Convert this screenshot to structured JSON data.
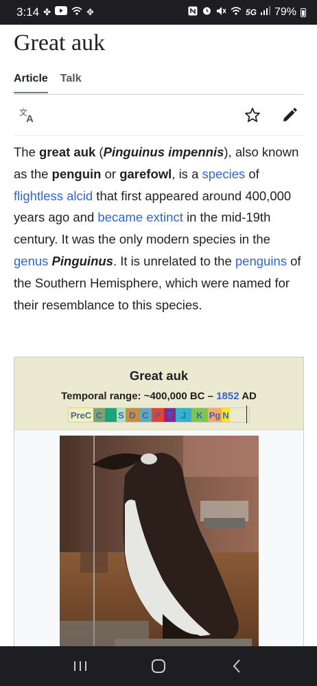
{
  "status_bar": {
    "time": "3:14",
    "left_icons": [
      "fan-icon",
      "youtube-icon",
      "wifi-calling-icon",
      "pinwheel-icon"
    ],
    "right_icons": [
      "nfc-icon",
      "alarm-icon",
      "mute-icon",
      "wifi-icon",
      "signal-icon"
    ],
    "network": "5G",
    "battery": "79%"
  },
  "page": {
    "title": "Great auk",
    "tabs": [
      {
        "label": "Article",
        "active": true
      },
      {
        "label": "Talk",
        "active": false
      }
    ]
  },
  "toolbar": {
    "icons": [
      "language-icon",
      "star-icon",
      "edit-pencil-icon"
    ]
  },
  "article": {
    "parts": {
      "p1": "The ",
      "b1": "great auk",
      "p2": " (",
      "bi1": "Pinguinus impennis",
      "p3": "), also known as the ",
      "b2": "penguin",
      "p4": " or ",
      "b3": "garefowl",
      "p5": ", is a ",
      "l1": "species",
      "p6": " of ",
      "l2": "flightless alcid",
      "p7": " that first appeared around 400,000 years ago and ",
      "l3": "became extinct",
      "p8": " in the mid-19th century. It was the only modern species in the ",
      "l4": "genus",
      "p9": " ",
      "bi2": "Pinguinus",
      "p10": ". It is unrelated to the ",
      "l5": "penguins",
      "p11": " of the Southern Hemisphere, which were named for their resemblance to this species."
    }
  },
  "infobox": {
    "title": "Great auk",
    "range_prefix": "Temporal range: ~400,000 BC – ",
    "range_link": "1852",
    "range_suffix": " AD",
    "timeline": [
      {
        "label": "PreC",
        "color": "#f7f0ae"
      },
      {
        "label": "C",
        "color": "#7fa56c"
      },
      {
        "label": "",
        "color": "#1aa47c"
      },
      {
        "label": "S",
        "color": "#b3e1b6"
      },
      {
        "label": "D",
        "color": "#cb8c37"
      },
      {
        "label": "C",
        "color": "#67a5b9"
      },
      {
        "label": "P",
        "color": "#f04028"
      },
      {
        "label": "T",
        "color": "#812b92"
      },
      {
        "label": "J",
        "color": "#34b2c9"
      },
      {
        "label": "K",
        "color": "#7fc64e"
      },
      {
        "label": "Pg",
        "color": "#fda75f"
      },
      {
        "label": "N",
        "color": "#ffe619"
      }
    ],
    "image_name": "great-auk-specimen-photo"
  },
  "nav_bar": {
    "buttons": [
      "recent-apps-icon",
      "home-icon",
      "back-icon"
    ]
  }
}
